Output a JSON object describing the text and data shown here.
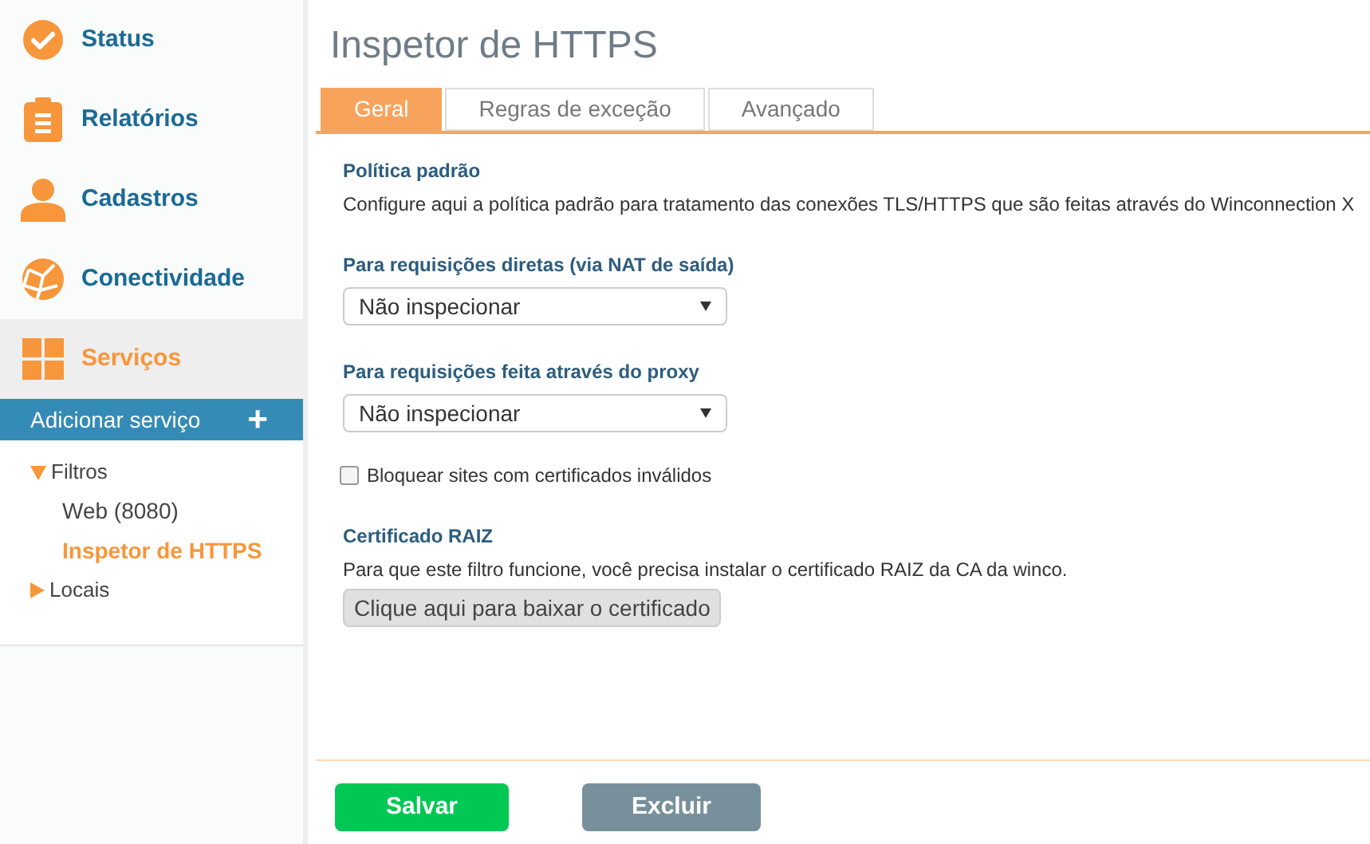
{
  "sidebar": {
    "nav": [
      {
        "label": "Status",
        "kind": "status",
        "selected": false
      },
      {
        "label": "Relatórios",
        "kind": "reports",
        "selected": false
      },
      {
        "label": "Cadastros",
        "kind": "people",
        "selected": false
      },
      {
        "label": "Conectividade",
        "kind": "network",
        "selected": false
      },
      {
        "label": "Serviços",
        "kind": "services",
        "selected": true
      }
    ],
    "add_button": {
      "label": "Adicionar serviço",
      "icon": "+"
    },
    "tree": [
      {
        "label": "Filtros",
        "expanded": true,
        "children": [
          {
            "label": "Web (8080)",
            "selected": false
          },
          {
            "label": "Inspetor de HTTPS",
            "selected": true
          }
        ]
      },
      {
        "label": "Locais",
        "expanded": false
      }
    ]
  },
  "page": {
    "title": "Inspetor de HTTPS",
    "tabs": [
      {
        "label": "Geral",
        "selected": true
      },
      {
        "label": "Regras de exceção",
        "selected": false
      },
      {
        "label": "Avançado",
        "selected": false
      }
    ],
    "policy": {
      "heading": "Política padrão",
      "description": "Configure aqui a política padrão para tratamento das conexões TLS/HTTPS que são feitas através do Winconnection X"
    },
    "selects": [
      {
        "label": "Para requisições diretas (via NAT de saída)",
        "value": "Não inspecionar"
      },
      {
        "label": "Para requisições feita através do proxy",
        "value": "Não inspecionar"
      }
    ],
    "block_checkbox": {
      "label": "Bloquear sites com certificados inválidos",
      "checked": false
    },
    "certificate": {
      "heading": "Certificado RAIZ",
      "description": "Para que este filtro funcione, você precisa instalar o certificado RAIZ da CA da winco.",
      "button": "Clique aqui para baixar o certificado"
    },
    "actions": [
      {
        "label": "Salvar",
        "kind": "primary"
      },
      {
        "label": "Excluir",
        "kind": "secondary"
      }
    ]
  }
}
